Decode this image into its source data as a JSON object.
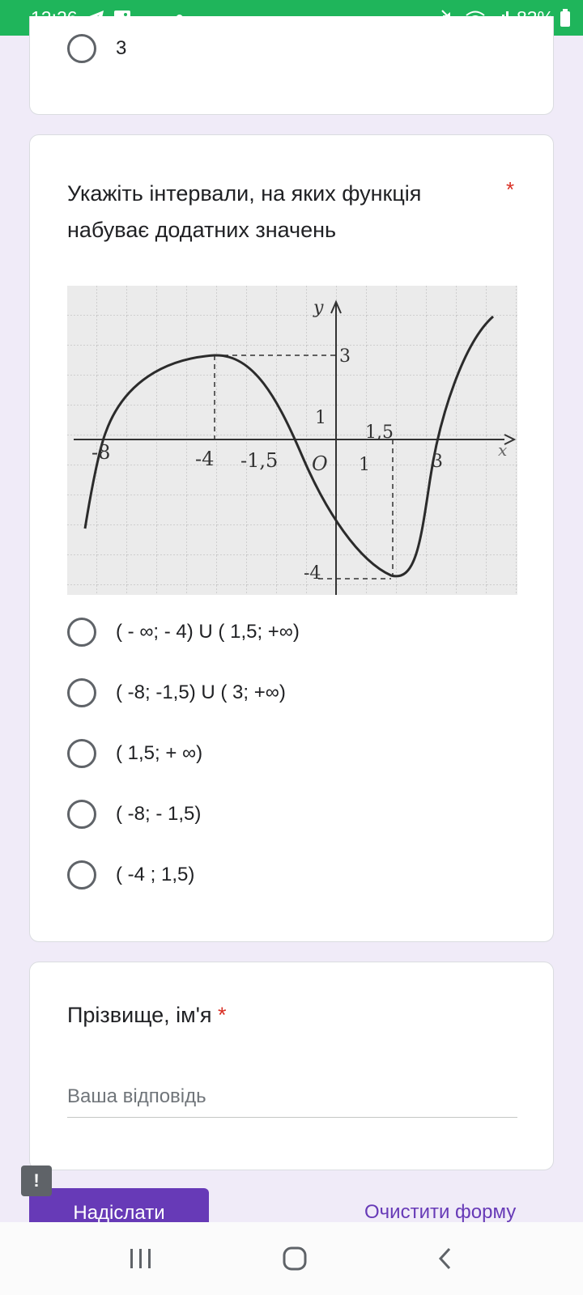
{
  "status_bar": {
    "time": "12:26",
    "battery": "83%",
    "icons": [
      "telegram-icon",
      "gallery-icon",
      "notification-dot",
      "mute-icon",
      "wifi-icon",
      "signal-icon",
      "battery-icon"
    ]
  },
  "prev_question": {
    "option_label": "3"
  },
  "question": {
    "title": "Укажіть інтервали, на яких функція набуває додатних значень",
    "required_mark": "*",
    "graph": {
      "axis_x": "x",
      "axis_y": "y",
      "tick_labels": [
        "-8",
        "-4",
        "-1,5",
        "O",
        "1",
        "1,5",
        "3",
        "1",
        "3",
        "-4"
      ]
    },
    "options": [
      "( - ∞; - 4) U ( 1,5; +∞)",
      "( -8; -1,5) U ( 3; +∞)",
      "( 1,5; + ∞)",
      "( -8; - 1,5)",
      "( -4 ; 1,5)"
    ]
  },
  "name_question": {
    "title": "Прізвище, ім'я",
    "required_mark": "*",
    "placeholder": "Ваша відповідь"
  },
  "footer": {
    "submit_label": "Надіслати",
    "clear_label": "Очистити форму",
    "alert_icon": "!"
  },
  "colors": {
    "status_bar": "#1fb55b",
    "page_bg": "#f0ebf8",
    "accent": "#673ab7",
    "required": "#d93025"
  }
}
